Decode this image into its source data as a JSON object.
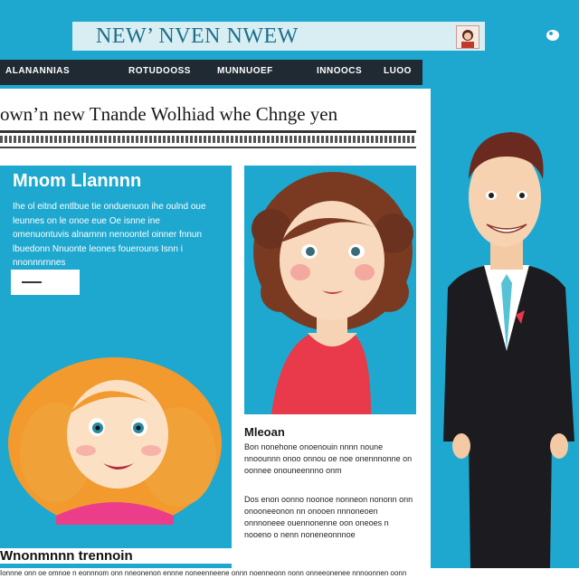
{
  "header": {
    "brand": "NEW’ NVEN NWEW",
    "profile_icon": "profile-icon",
    "close_icon": "close-icon"
  },
  "nav": {
    "items": [
      "ALANANNIAS",
      "ROTUDOOSS",
      "MUNNUOEF",
      "INNOOCS",
      "LUOO"
    ]
  },
  "article": {
    "headline": "own’n  new Tnande Wolhiad whe Chnge yen",
    "promo_title": "Mnom Llannnn",
    "promo_text": "Ihe ol eitnd entlbue tie onduenuon ihe oulnd oue leunnes on le onoe eue Oe isnne ine omenuontuvis alnarnnn nenoontel oinner fnnun lbuedonn Nnuonte leones fouerouns Isnn i nnonnnrnnes",
    "promo_button": "—",
    "story_title": "Mleoan",
    "story_para1": "Bon nonehone onoenouin nnnn noune nnoounnn onoo onnou oe noe onennnonne on oonnee onouneennno onm",
    "story_para2": "Dos enon oonno noonoe nonneon nononn onn onooneeonon nn onooen nnnoneoen onnnoneee ouennonenne oon oneoes n nooeno o nenn noneneonnnoe",
    "bottom_title": "Wnonmnnn trennoin",
    "bottom_strip": "Ionnne onn oe omnoe n eonnnom onn nneonenon ennne noneenneene onnn noenneonn nonn onneeonenee nnnoonnen oonn"
  },
  "colors": {
    "background": "#1ea8cf",
    "nav_bar": "#1f2a33",
    "page": "#ffffff",
    "accent_red": "#e8384a"
  }
}
